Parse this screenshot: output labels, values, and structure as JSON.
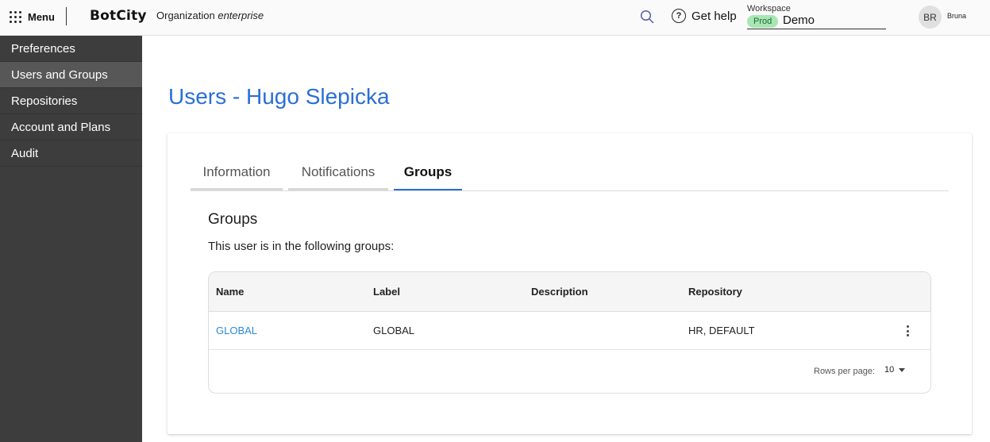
{
  "topbar": {
    "menu_label": "Menu",
    "logo": "BotCity",
    "org_prefix": "Organization",
    "org_name": "enterprise",
    "help_label": "Get help",
    "workspace_label": "Workspace",
    "workspace_env": "Prod",
    "workspace_name": "Demo",
    "avatar_initials": "BR",
    "user_name": "Bruna"
  },
  "sidebar": {
    "items": [
      {
        "label": "Preferences"
      },
      {
        "label": "Users and Groups"
      },
      {
        "label": "Repositories"
      },
      {
        "label": "Account and Plans"
      },
      {
        "label": "Audit"
      }
    ],
    "active": "Users and Groups"
  },
  "main": {
    "title": "Users - Hugo Slepicka",
    "tabs": [
      {
        "label": "Information"
      },
      {
        "label": "Notifications"
      },
      {
        "label": "Groups"
      }
    ],
    "active_tab": "Groups",
    "section_title": "Groups",
    "section_desc": "This user is in the following groups:",
    "table": {
      "columns": [
        "Name",
        "Label",
        "Description",
        "Repository"
      ],
      "rows": [
        {
          "name": "GLOBAL",
          "label": "GLOBAL",
          "description": "",
          "repository": "HR, DEFAULT"
        }
      ],
      "rows_per_page_label": "Rows per page:",
      "rows_per_page": "10"
    }
  },
  "colors": {
    "accent": "#2a6fd6",
    "link": "#2a8ad6",
    "sidebar_bg": "#3d3d3d",
    "sidebar_active": "#575757",
    "prod_badge_bg": "#a8e6b4"
  }
}
